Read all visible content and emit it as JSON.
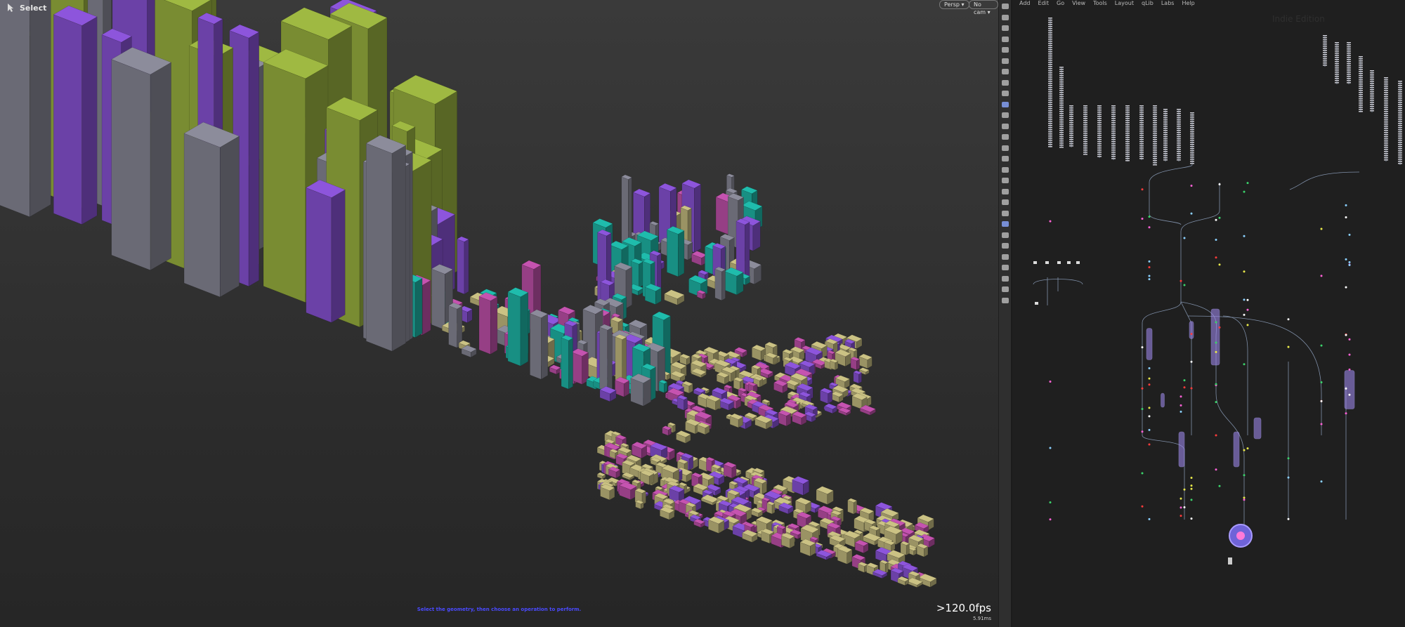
{
  "viewport": {
    "tool_label": "Select",
    "persp_label": "Persp ▾",
    "cam_label": "No cam ▾",
    "hint_text": "Select the geometry, then choose an operation to perform.",
    "fps": ">120.0fps",
    "frame_time": "5.91ms"
  },
  "network": {
    "menu": [
      "Add",
      "Edit",
      "Go",
      "View",
      "Tools",
      "Layout",
      "qLib",
      "Labs",
      "Help"
    ],
    "watermark": "Indie Edition"
  },
  "colors": {
    "green": "#8ea53b",
    "purple": "#7e4cc4",
    "teal": "#1ca89a",
    "grey": "#7d7d8a",
    "pink": "#b04a9d",
    "khaki": "#b5ad76",
    "hint": "#4a4aff",
    "node_wire": "#7f8fa8",
    "node_fill": "#9b86e8"
  },
  "toolbar_icons": [
    "select-icon",
    "transform-icon",
    "lock-icon",
    "scale-icon",
    "handle-icon",
    "light-icon",
    "camera-icon",
    "snap-icon",
    "pivot-icon",
    "ruler-icon",
    "paint-icon",
    "sculpt-icon",
    "brush-icon",
    "pen-icon",
    "curve-icon",
    "knife-icon",
    "gear-icon",
    "grid-icon",
    "measure-icon",
    "eye-icon",
    "palette-icon",
    "box-icon",
    "sphere-icon",
    "geo-icon",
    "light2-icon",
    "cube-icon",
    "display-icon",
    "render-icon"
  ]
}
